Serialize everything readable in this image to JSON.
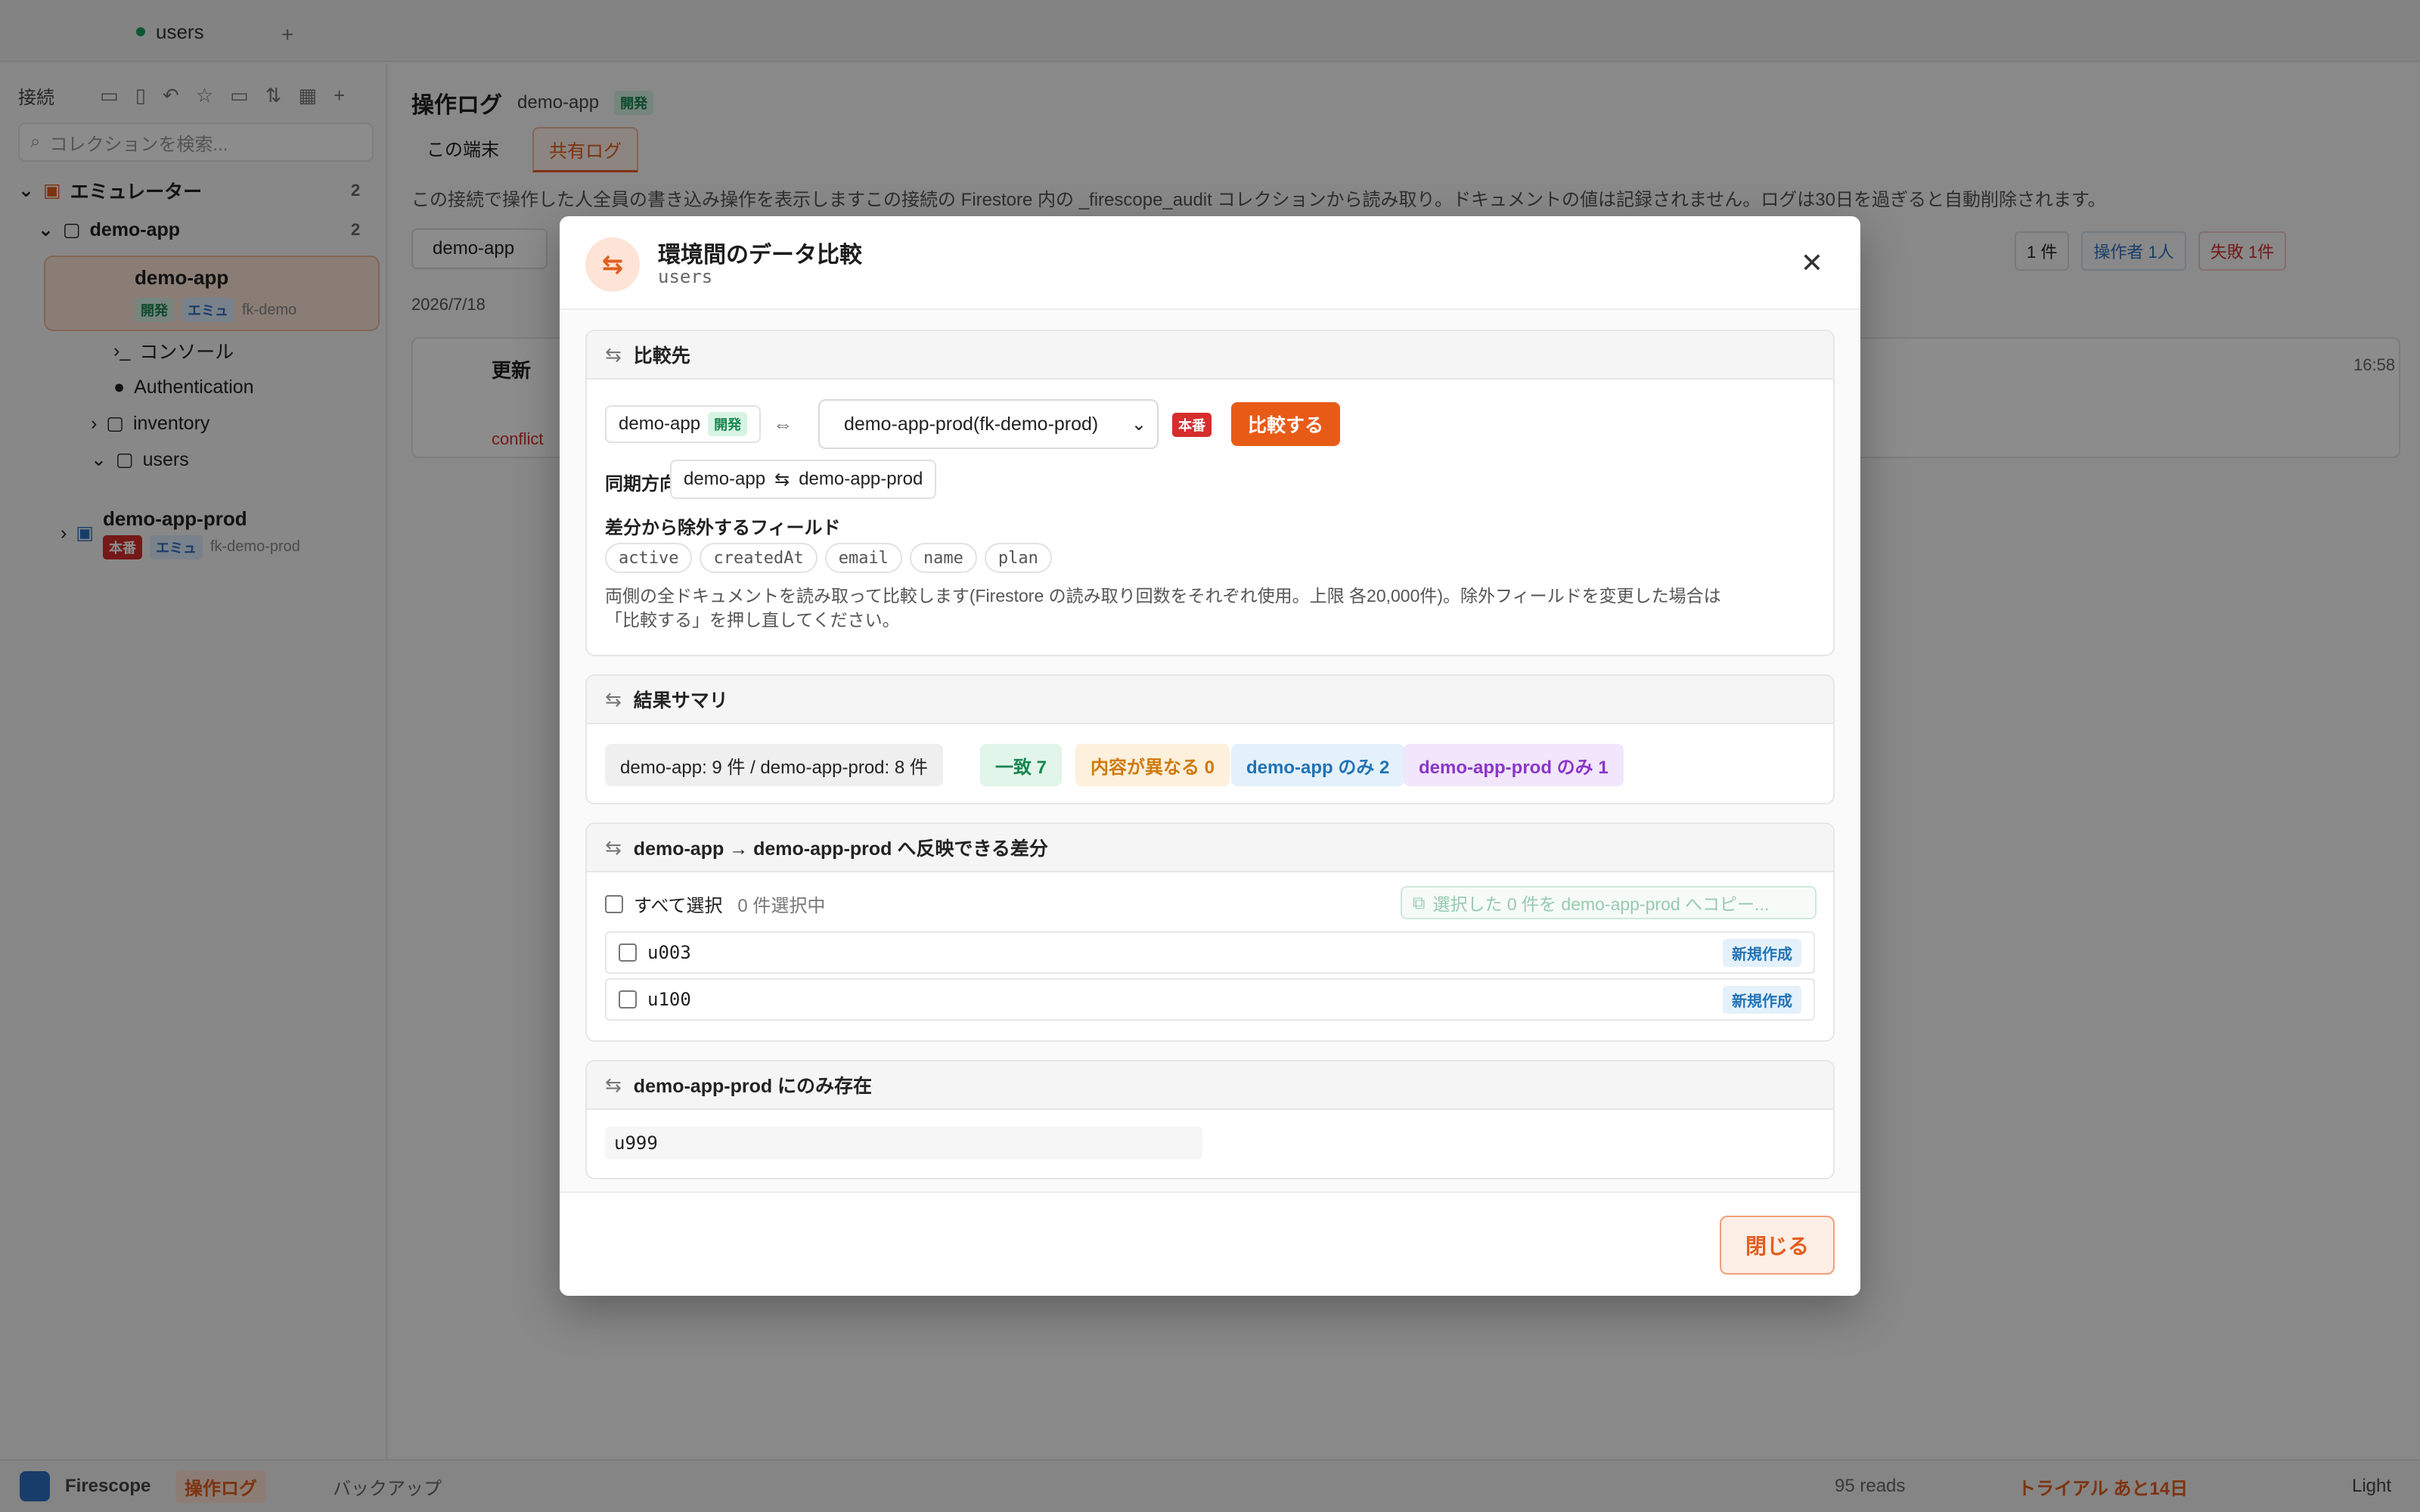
{
  "tabbar": {
    "tab_label": "users",
    "add": "+"
  },
  "sidebar": {
    "header": "接続",
    "search_placeholder": "コレクションを検索...",
    "emulator_group": "エミュレーター",
    "emulator_count": "2",
    "demo_app_folder": "demo-app",
    "demo_app_folder_count": "2",
    "selected_project": {
      "name": "demo-app",
      "badge_dev": "開発",
      "badge_emu": "エミュ",
      "project_id": "fk-demo"
    },
    "children": [
      "コンソール",
      "Authentication",
      "inventory",
      "users"
    ],
    "prod_project": {
      "name": "demo-app-prod",
      "badge_prod": "本番",
      "badge_emu": "エミュ",
      "project_id": "fk-demo-prod"
    }
  },
  "main": {
    "title": "操作ログ",
    "project": "demo-app",
    "project_badge": "開発",
    "tabs": [
      "この端末",
      "共有ログ"
    ],
    "description": "この接続で操作した人全員の書き込み操作を表示しますこの接続の Firestore 内の _firescope_audit コレクションから読み取り。ドキュメントの値は記録されません。ログは30日を過ぎると自動削除されます。",
    "filter_value": "demo-app",
    "date": "2026/7/18",
    "log_entry_label": "更新",
    "log_time": "16:58",
    "log_sub": "conflict",
    "stats": [
      "1 件",
      "操作者 1人",
      "失敗 1件"
    ]
  },
  "modal": {
    "title": "環境間のデータ比較",
    "subtitle": "users",
    "icon": "swap-icon",
    "compare_section": {
      "title": "比較先",
      "source_name": "demo-app",
      "source_badge": "開発",
      "arrow": "⇔",
      "target_select": "demo-app-prod(fk-demo-prod)",
      "target_badge": "本番",
      "compare_button": "比較する",
      "sync_label": "同期方向",
      "sync_from": "demo-app",
      "sync_symbol": "⇆",
      "sync_to": "demo-app-prod",
      "exclude_label": "差分から除外するフィールド",
      "exclude_fields": [
        "active",
        "createdAt",
        "email",
        "name",
        "plan"
      ],
      "note_line1": "両側の全ドキュメントを読み取って比較します(Firestore の読み取り回数をそれぞれ使用。上限 各20,000件)。除外フィールドを変更した場合は",
      "note_line2": "「比較する」を押し直してください。"
    },
    "summary_section": {
      "title": "結果サマリ",
      "counts": "demo-app: 9 件 / demo-app-prod: 8 件",
      "match": "一致 7",
      "different": "内容が異なる 0",
      "only_source": "demo-app のみ 2",
      "only_target": "demo-app-prod のみ 1"
    },
    "diff_section": {
      "title": "demo-app → demo-app-prod へ反映できる差分",
      "select_all": "すべて選択",
      "selected_count": "0 件選択中",
      "copy_button": "選択した 0 件を demo-app-prod へコピー...",
      "rows": [
        {
          "id": "u003",
          "badge": "新規作成"
        },
        {
          "id": "u100",
          "badge": "新規作成"
        }
      ]
    },
    "target_only_section": {
      "title": "demo-app-prod にのみ存在",
      "items": [
        "u999"
      ]
    },
    "close_button": "閉じる"
  },
  "statusbar": {
    "app_name": "Firescope",
    "active_item": "操作ログ",
    "backup": "バックアップ",
    "reads": "95 reads",
    "trial": "トライアル あと14日",
    "theme": "Light"
  },
  "colors": {
    "accent": "#e85b17",
    "dev_green": "#17864f",
    "prod_red": "#d62d2d"
  }
}
